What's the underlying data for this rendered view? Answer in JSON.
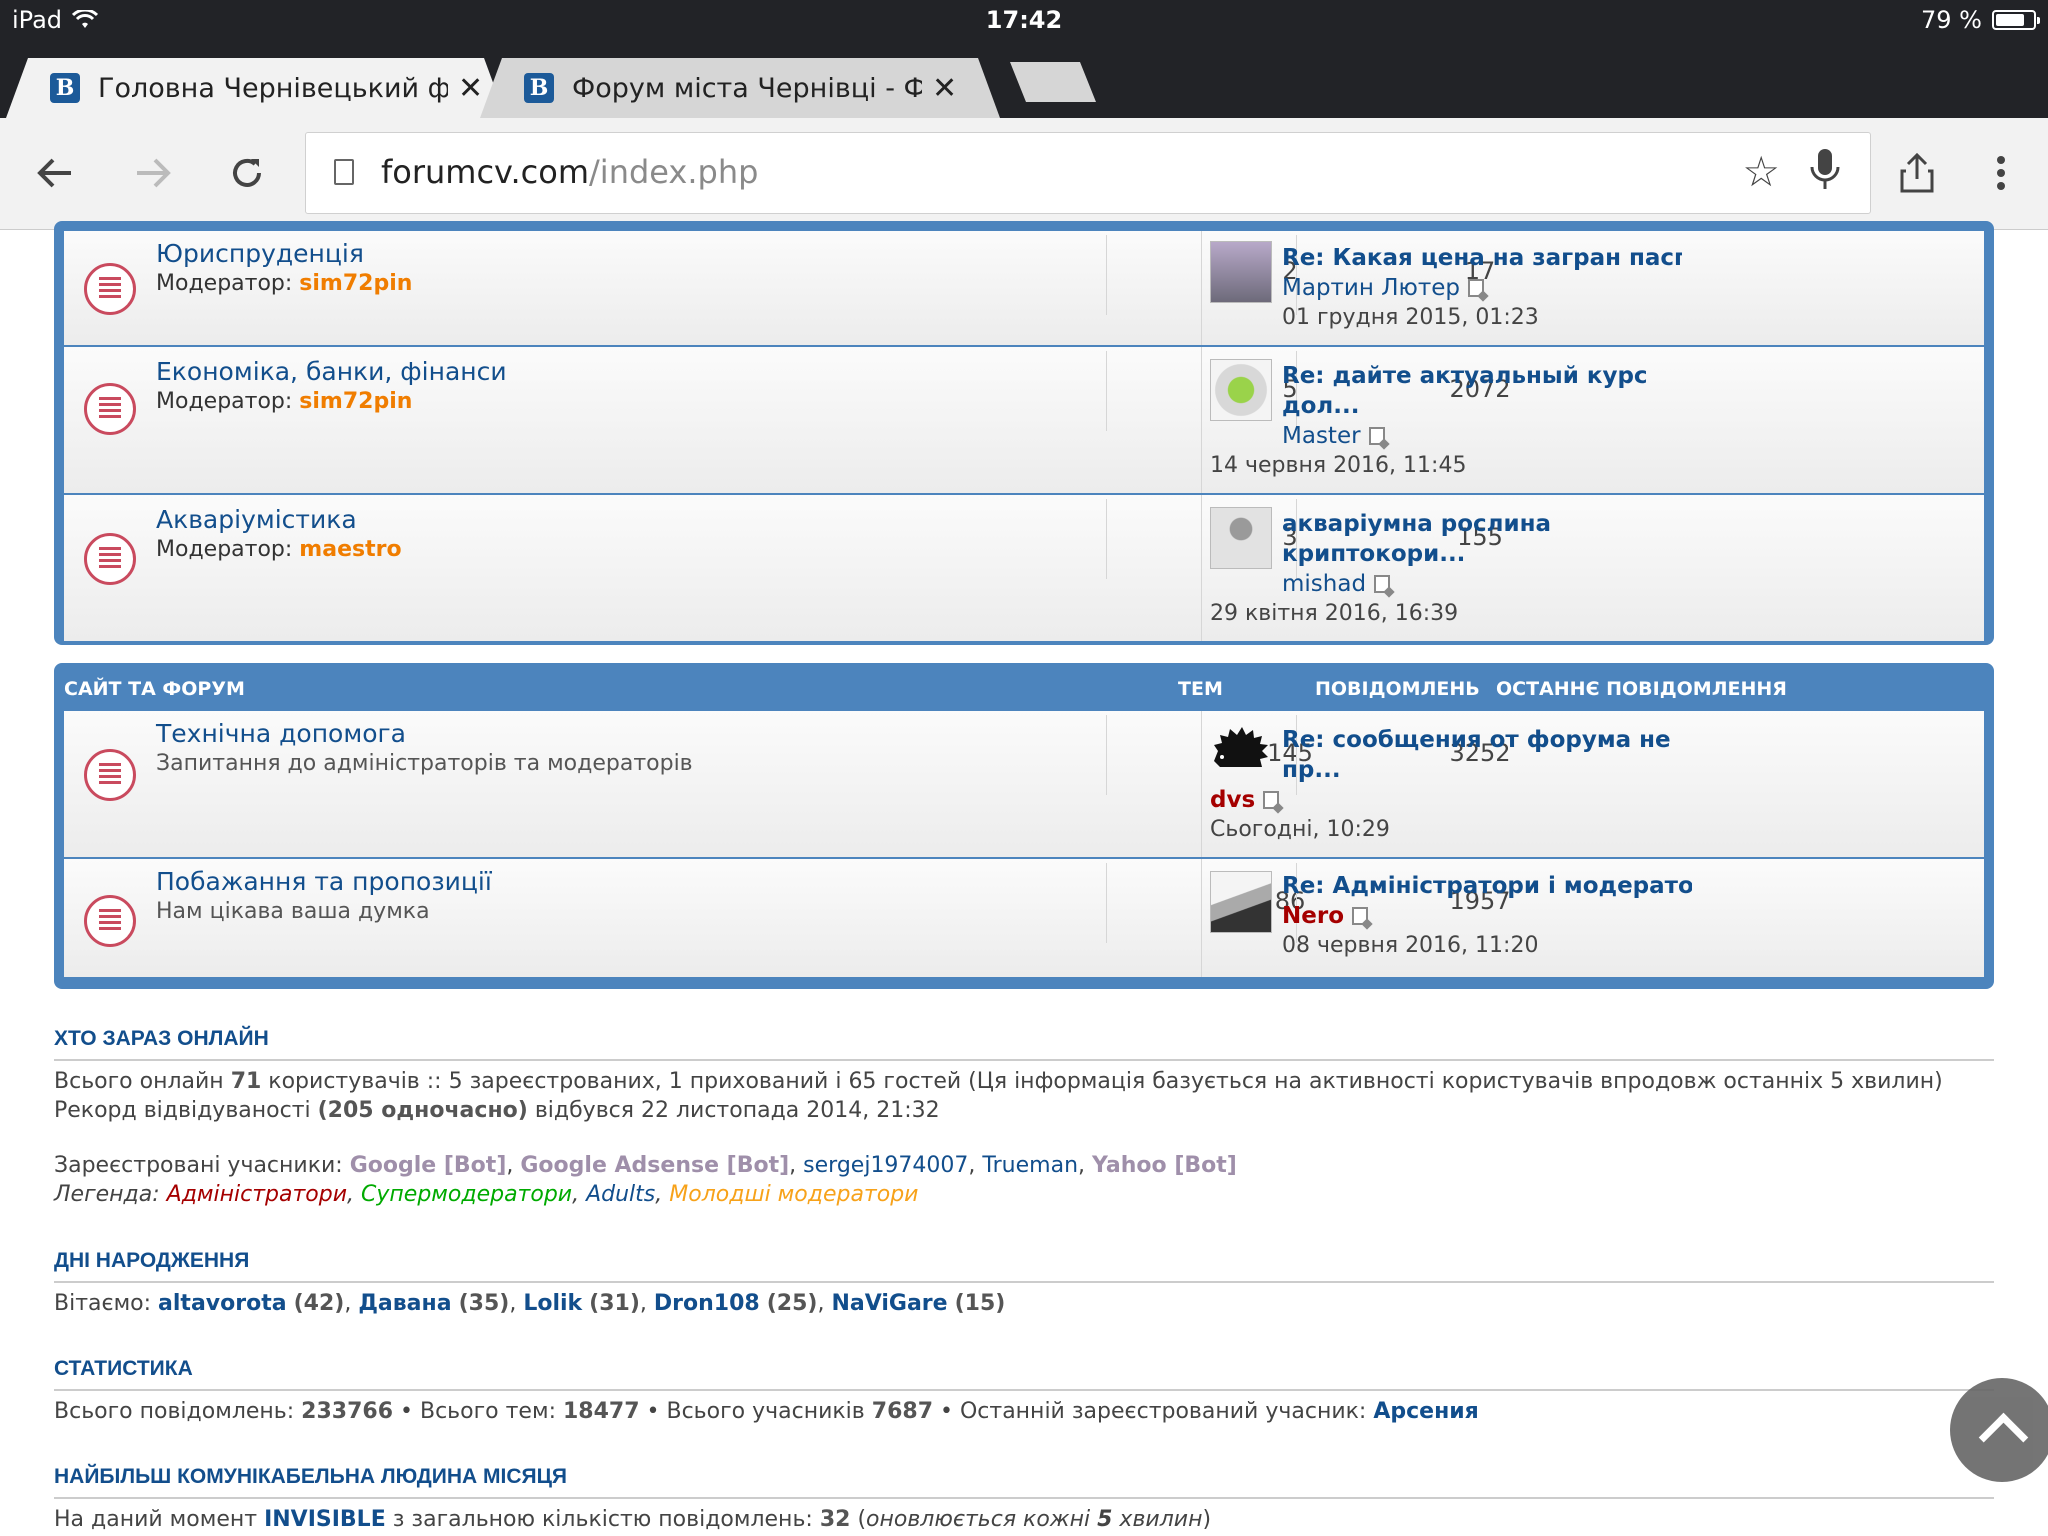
{
  "status": {
    "device": "iPad",
    "time": "17:42",
    "battery": "79 %",
    "battery_level": 0.79
  },
  "tabs": [
    {
      "title": "Головна Чернівецький фор",
      "active": true
    },
    {
      "title": "Форум міста Чернівці - Фо",
      "active": false
    }
  ],
  "toolbar": {
    "url_host": "forumcv.com",
    "url_path": "/index.php"
  },
  "sections": {
    "first": {
      "rows": [
        {
          "title": "Юриспруденція",
          "mod_label": "Модератор:",
          "mod": "sim72pin",
          "topics": "2",
          "posts": "17",
          "last_title": "Re: Какая цена на загран пасп...",
          "last_user": "Мартин Лютер",
          "last_date": "01 грудня 2015, 01:23"
        },
        {
          "title": "Економіка, банки, фінанси",
          "mod_label": "Модератор:",
          "mod": "sim72pin",
          "topics": "5",
          "posts": "2072",
          "last_title": "Re: дайте актуальный курс дол...",
          "last_user": "Master",
          "last_date": "14 червня 2016, 11:45"
        },
        {
          "title": "Акваріумістика",
          "mod_label": "Модератор:",
          "mod": "maestro",
          "topics": "3",
          "posts": "155",
          "last_title": "акваріумна рослина криптокори...",
          "last_user": "mishad",
          "last_date": "29 квітня 2016, 16:39"
        }
      ]
    },
    "site": {
      "header": "САЙТ ТА ФОРУМ",
      "col_topics": "ТЕМ",
      "col_posts": "ПОВІДОМЛЕНЬ",
      "col_last": "ОСТАННЄ ПОВІДОМЛЕННЯ",
      "rows": [
        {
          "title": "Технічна допомога",
          "desc": "Запитання до адміністраторів та модераторів",
          "topics": "145",
          "posts": "3252",
          "last_title": "Re: сообщения от форума не пр...",
          "last_user": "dvs",
          "last_date": "Сьогодні, 10:29"
        },
        {
          "title": "Побажання та пропозиції",
          "desc": "Нам цікава ваша думка",
          "topics": "86",
          "posts": "1957",
          "last_title": "Re: Адміністратори і модерато...",
          "last_user": "Nero",
          "last_date": "08 червня 2016, 11:20"
        }
      ]
    }
  },
  "online": {
    "heading": "ХТО ЗАРАЗ ОНЛАЙН",
    "l1_a": "Всього онлайн ",
    "l1_total": "71",
    "l1_b": " користувачів :: 5 зареєстрованих, 1 прихований і 65 гостей (Ця інформація базується на активності користувачів впродовж останніх 5 хвилин)",
    "l2_a": "Рекорд відвідуваності ",
    "l2_record": "(205 одночасно)",
    "l2_b": " відбувся 22 листопада 2014, 21:32",
    "reg_label": "Зареєстровані учасники: ",
    "users": [
      "Google [Bot]",
      "Google Adsense [Bot]",
      "sergej1974007",
      "Trueman",
      "Yahoo [Bot]"
    ],
    "legend_label": "Легенда: ",
    "legend": [
      "Адміністратори",
      "Супермодератори",
      "Adults",
      "Молодші модератори"
    ]
  },
  "birthdays": {
    "heading": "ДНІ НАРОДЖЕННЯ",
    "label": "Вітаємо: ",
    "people": [
      {
        "name": "altavorota",
        "age": "(42)"
      },
      {
        "name": "Давана",
        "age": "(35)"
      },
      {
        "name": "Lolik",
        "age": "(31)"
      },
      {
        "name": "Dron108",
        "age": "(25)"
      },
      {
        "name": "NaViGare",
        "age": "(15)"
      }
    ]
  },
  "stats": {
    "heading": "СТАТИСТИКА",
    "posts_label": "Всього повідомлень: ",
    "posts": "233766",
    "topics_label": " • Всього тем: ",
    "topics": "18477",
    "members_label": " • Всього учасників ",
    "members": "7687",
    "newest_label": " • Останній зареєстрований учасник: ",
    "newest": "Арсения"
  },
  "top": {
    "heading": "НАЙБІЛЬШ КОМУНІКАБЕЛЬНА ЛЮДИНА МІСЯЦЯ",
    "a": "На даний момент ",
    "user": "INVISIBLE",
    "b": " з загальною кількістю повідомлень: ",
    "count": "32",
    "c1": " (",
    "c2": "оновлюється кожні ",
    "c3": "5",
    "c4": " хвилин",
    "c5": ")"
  }
}
